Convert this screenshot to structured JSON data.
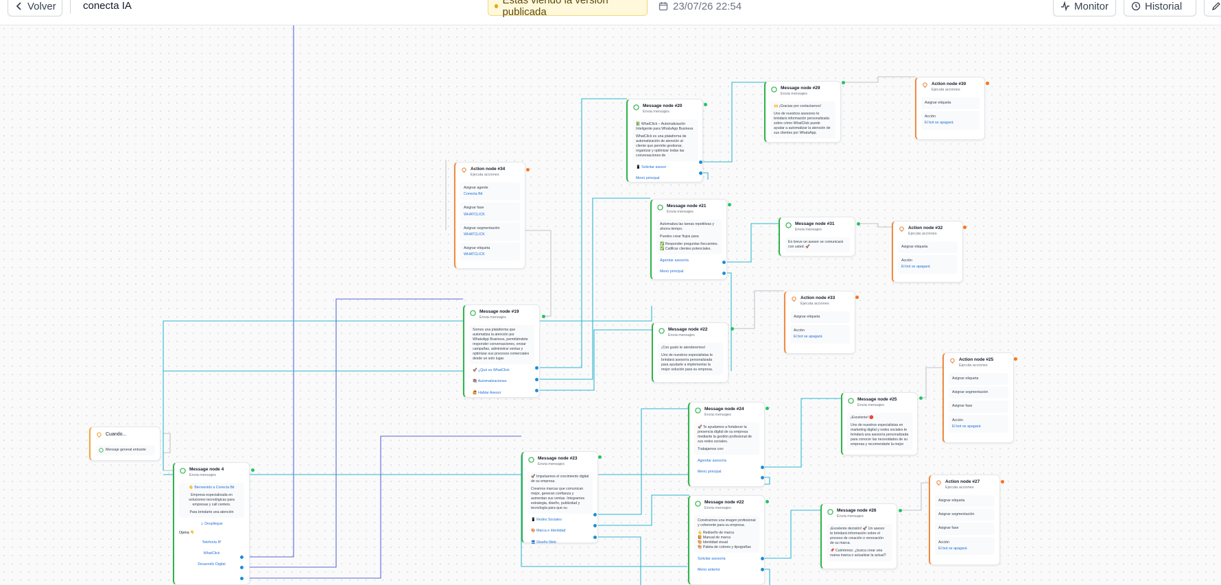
{
  "topbar": {
    "back_label": "Volver",
    "flow_name": "conecta IA",
    "published_notice": "Estas viendo la versión publicada",
    "datetime": "23/07/26 22:54",
    "monitor_label": "Monitor",
    "history_label": "Historial",
    "icons": {
      "back": "chevron-left-icon",
      "calendar": "calendar-icon",
      "monitor": "activity-icon",
      "history": "history-icon",
      "edit": "pencil-icon"
    }
  },
  "colors": {
    "message_accent": "#2cb34a",
    "action_accent": "#f08a3e",
    "edge_blue": "#2ab7d0",
    "edge_indigo": "#5567d8",
    "notice_bg": "#fff8db"
  },
  "nodes": {
    "trigger": {
      "title": "Cuando...",
      "event": "Mensaje general entrante"
    },
    "m4": {
      "title": "Message node 4",
      "sub": "Envia mensajes",
      "greeting": "👋 Bienvenido a Conecta Bit",
      "text": "Empresa especializada en soluciones tecnológicas para empresas y call centers.",
      "text2": "Para brindarte una atención",
      "deploy": "Despliegue",
      "options_label": "Opina 👇",
      "b1": "Telefonía IP",
      "b2": "WhatClick",
      "b3": "Desarrollo Digital"
    },
    "m19": {
      "title": "Message node #19",
      "sub": "Envia mensajes",
      "text": "Somos una plataforma que automatiza la atención por WhatsApp Business, permitiéndote responder conversaciones, enviar campañas, administrar ventas y optimizar sus procesos comerciales desde un solo lugar.",
      "b1": "🚀 ¿Qué es WhatClick",
      "b2": "📚 Automatizaciones",
      "b3": "🙋 Hablar Asesor"
    },
    "a34": {
      "title": "Action node #34",
      "sub": "Ejecuta acciones",
      "r1": "Asignar agente",
      "r1v": "Conecta Bit",
      "r2": "Asignar fase",
      "r2v": "WHATCLICK",
      "r3": "Asignar segmentación",
      "r3v": "WHATCLICK",
      "r4": "Asignar etiqueta",
      "r4v": "WHATCLICK"
    },
    "m20": {
      "title": "Message node #20",
      "sub": "Envia mensajes",
      "p1": "📗 WhatClick – Automatización Inteligente para WhatsApp Business",
      "p2": "WhatClick es una plataforma de automatización de atención al cliente que permite gestionar, organizar y optimizar todas las conversaciones de",
      "b1": "📱 Solicitar asesor",
      "b2": "Menú principal"
    },
    "m29": {
      "title": "Message node #29",
      "sub": "Envia mensajes",
      "p1": "🙌 ¡Gracias por contactarnos!",
      "p2": "Uno de nuestros asesores te brindará información personalizada sobre cómo WhatClick puede ayudar a automatizar la atención de sus clientes por WhatsApp."
    },
    "a30": {
      "title": "Action node #30",
      "sub": "Ejecuta acciones",
      "r1": "Asignar etiqueta",
      "r2": "Acción",
      "r2v": "El bot se apagará"
    },
    "m21": {
      "title": "Message node #21",
      "sub": "Envia mensajes",
      "p1": "Automatiza las tareas repetitivas y ahorra tiempo.",
      "p2": "Puedes crear flujos para:",
      "c1": "✅ Responder preguntas frecuentes.",
      "c2": "✅ Calificar clientes potenciales.",
      "b1": "Agendar asesoría",
      "b2": "Menú principal"
    },
    "m31": {
      "title": "Message node #31",
      "sub": "Envia mensajes",
      "p1": "En breve un asesor se comunicará con usted. 🚀"
    },
    "a32": {
      "title": "Action node #32",
      "sub": "Ejecuta acciones",
      "r1": "Asignar etiqueta",
      "r2": "Acción",
      "r2v": "El bot se apagará"
    },
    "a33": {
      "title": "Action node #33",
      "sub": "Ejecuta acciones",
      "r1": "Asignar etiqueta",
      "r2": "Acción",
      "r2v": "El bot se apagará"
    },
    "m22a": {
      "title": "Message node #22",
      "sub": "Envia mensajes",
      "p1": "¡Con gusto te atenderemos!",
      "p2": "Uno de nuestros especialistas te brindará asesoría personalizada para ayudarte a implementar la mejor solución para su empresa."
    },
    "m24": {
      "title": "Message node #24",
      "sub": "Envia mensajes",
      "p1": "🚀 Te ayudamos a fortalecer la presencia digital de su empresa mediante la gestión profesional de sus redes sociales.",
      "p2": "Trabajamos con:",
      "b1": "Agendar asesoría",
      "b2": "Menú principal"
    },
    "m25": {
      "title": "Message node #25",
      "sub": "Envia mensajes",
      "p1": "¡Excelente! 🔴",
      "p2": "Uno de nuestros especialistas en marketing digital y redes sociales te brindará una asesoría personalizada para conocer las necesidades de su empresa y recomendarle la mejor"
    },
    "a25": {
      "title": "Action node #25",
      "sub": "Ejecuta acciones",
      "r1": "Asignar etiqueta",
      "r2": "Asignar segmentación",
      "r3": "Asignar fase",
      "r4": "Acción",
      "r4v": "El bot se apagará"
    },
    "m23": {
      "title": "Message node #23",
      "sub": "Envia mensajes",
      "p1": "🚀 Impulsamos el crecimiento digital de su empresa.",
      "p2": "Creamos marcas que comunican mejor, generan confianza y aumentan sus ventas. Integramos estrategia, diseño, publicidad y tecnología para que su",
      "b1": "📱 Redes Sociales",
      "b2": "🎨 Marca e Identidad",
      "b3": "🖥 Diseño Web"
    },
    "m22b": {
      "title": "Message node #22",
      "sub": "Envia mensajes",
      "p1": "Construimos una imagen profesional y coherente para su empresa.",
      "l1": "👆 Rediseño de marca",
      "l2": "📙 Manual de marca",
      "l3": "🎨 Identidad visual",
      "l4": "🎨 Paleta de colores y tipografías",
      "b1": "Solicitar asesoría",
      "b2": "Menú anterior"
    },
    "m26": {
      "title": "Message node #26",
      "sub": "Envia mensajes",
      "p1": "¡Excelente decisión! 🚀 Un asesor te brindará información sobre el proceso de creación o renovación de su marca.",
      "p2": "📌 Cuéntenos: ¿busca crear una nueva marca o actualizar la actual?"
    },
    "a27": {
      "title": "Action node #27",
      "sub": "Ejecuta acciones",
      "r1": "Asignar etiqueta",
      "r2": "Asignar segmentación",
      "r3": "Asignar fase",
      "r4": "Acción",
      "r4v": "El bot se apagará"
    }
  }
}
